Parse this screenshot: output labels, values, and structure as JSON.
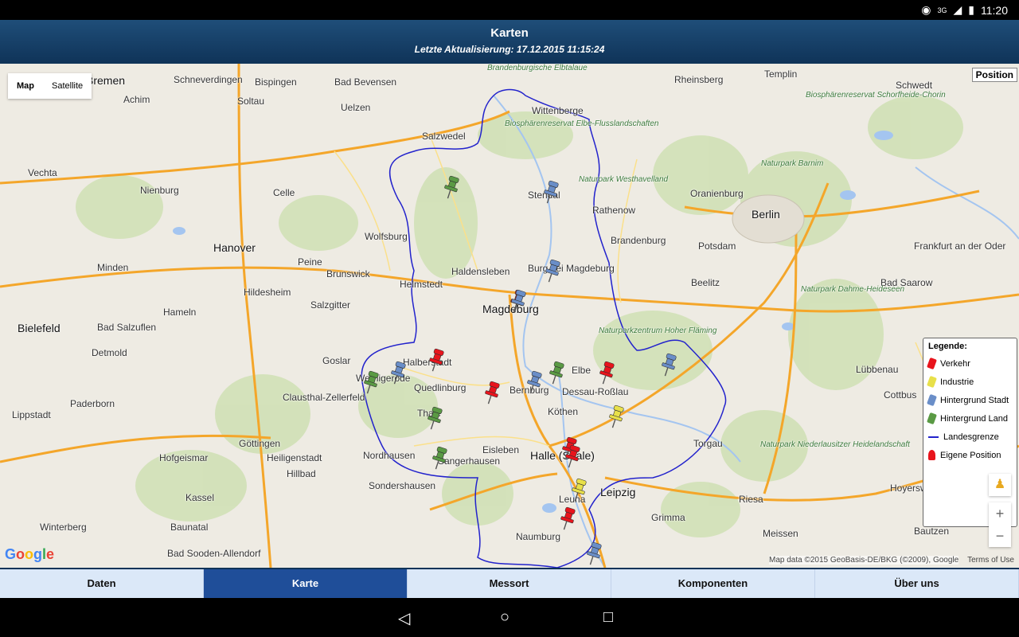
{
  "status": {
    "time": "11:20",
    "network": "3G"
  },
  "header": {
    "title": "Karten",
    "subtitle": "Letzte Aktualisierung: 17.12.2015 11:15:24"
  },
  "map": {
    "map_type_options": [
      "Map",
      "Satellite"
    ],
    "position_button": "Position",
    "places": [
      {
        "label": "Bremen",
        "big": true
      },
      {
        "label": "Schneverdingen"
      },
      {
        "label": "Bispingen"
      },
      {
        "label": "Bad Bevensen"
      },
      {
        "label": "Uelzen"
      },
      {
        "label": "Soltau"
      },
      {
        "label": "Achim"
      },
      {
        "label": "Vechta"
      },
      {
        "label": "Nienburg"
      },
      {
        "label": "Celle"
      },
      {
        "label": "Hanover",
        "big": true
      },
      {
        "label": "Wolfsburg"
      },
      {
        "label": "Peine"
      },
      {
        "label": "Brunswick"
      },
      {
        "label": "Minden"
      },
      {
        "label": "Hildesheim"
      },
      {
        "label": "Salzgitter"
      },
      {
        "label": "Hameln"
      },
      {
        "label": "Bielefeld",
        "big": true
      },
      {
        "label": "Bad Salzuflen"
      },
      {
        "label": "Detmold"
      },
      {
        "label": "Goslar"
      },
      {
        "label": "Paderborn"
      },
      {
        "label": "Clausthal-Zellerfeld"
      },
      {
        "label": "Lippstadt"
      },
      {
        "label": "Göttingen"
      },
      {
        "label": "Hofgeismar"
      },
      {
        "label": "Heiligenstadt"
      },
      {
        "label": "Kassel"
      },
      {
        "label": "Baunatal"
      },
      {
        "label": "Winterberg"
      },
      {
        "label": "Bad Sooden-Allendorf"
      },
      {
        "label": "Hillbad"
      },
      {
        "label": "Salzwedel"
      },
      {
        "label": "Wittenberge"
      },
      {
        "label": "Stendal"
      },
      {
        "label": "Haldensleben"
      },
      {
        "label": "Helmstedt"
      },
      {
        "label": "Burg bei Magdeburg"
      },
      {
        "label": "Magdeburg",
        "big": true
      },
      {
        "label": "Halberstadt"
      },
      {
        "label": "Wernigerode"
      },
      {
        "label": "Quedlinburg"
      },
      {
        "label": "Bernburg"
      },
      {
        "label": "Dessau-Roßlau"
      },
      {
        "label": "Köthen"
      },
      {
        "label": "Thale"
      },
      {
        "label": "Nordhausen"
      },
      {
        "label": "Sangerhausen"
      },
      {
        "label": "Eisleben"
      },
      {
        "label": "Halle (Saale)",
        "big": true
      },
      {
        "label": "Sondershausen"
      },
      {
        "label": "Leuna"
      },
      {
        "label": "Naumburg"
      },
      {
        "label": "Leipzig",
        "big": true
      },
      {
        "label": "Grimma"
      },
      {
        "label": "Riesa"
      },
      {
        "label": "Meissen"
      },
      {
        "label": "Torgau"
      },
      {
        "label": "Rheinsberg"
      },
      {
        "label": "Templin"
      },
      {
        "label": "Schwedt"
      },
      {
        "label": "Oranienburg"
      },
      {
        "label": "Rathenow"
      },
      {
        "label": "Berlin",
        "big": true
      },
      {
        "label": "Brandenburg"
      },
      {
        "label": "Potsdam"
      },
      {
        "label": "Frankfurt an der Oder"
      },
      {
        "label": "Beelitz"
      },
      {
        "label": "Bad Saarow"
      },
      {
        "label": "Lübbenau"
      },
      {
        "label": "Cottbus"
      },
      {
        "label": "Hoyerswerda"
      },
      {
        "label": "Bautzen"
      },
      {
        "label": "Elbe"
      },
      {
        "label": "Brandenburgische Elbtalaue",
        "green": true
      },
      {
        "label": "Biosphärenreservat Elbe-Flusslandschaften",
        "green": true
      },
      {
        "label": "Naturpark Westhavelland",
        "green": true
      },
      {
        "label": "Naturpark Barnim",
        "green": true
      },
      {
        "label": "Biosphärenreservat Schorfheide-Chorin",
        "green": true
      },
      {
        "label": "Naturpark Dahme-Heideseen",
        "green": true
      },
      {
        "label": "Naturparkzentrum Hoher Fläming",
        "green": true
      },
      {
        "label": "Naturpark Niederlausitzer Heidelandschaft",
        "green": true
      }
    ],
    "attribution": "Map data ©2015 GeoBasis-DE/BKG (©2009), Google",
    "terms": "Terms of Use",
    "google_logo": "Google"
  },
  "legend": {
    "title": "Legende:",
    "items": [
      {
        "label": "Verkehr",
        "color": "#e8141c"
      },
      {
        "label": "Industrie",
        "color": "#e8e04a"
      },
      {
        "label": "Hintergrund Stadt",
        "color": "#6a8ec8"
      },
      {
        "label": "Hintergrund Land",
        "color": "#5a9a44"
      },
      {
        "label": "Landesgrenze",
        "color": "#2222cc"
      },
      {
        "label": "Eigene Position",
        "color": "#e8141c"
      }
    ]
  },
  "tabs": [
    {
      "label": "Daten",
      "active": false
    },
    {
      "label": "Karte",
      "active": true
    },
    {
      "label": "Messort",
      "active": false
    },
    {
      "label": "Komponenten",
      "active": false
    },
    {
      "label": "Über uns",
      "active": false
    }
  ],
  "pins": [
    {
      "type": "Hintergrund Land",
      "color": "#5a9a44"
    },
    {
      "type": "Hintergrund Stadt",
      "color": "#6a8ec8"
    },
    {
      "type": "Hintergrund Stadt",
      "color": "#6a8ec8"
    },
    {
      "type": "Verkehr",
      "color": "#e8141c"
    },
    {
      "type": "Hintergrund Stadt",
      "color": "#6a8ec8"
    },
    {
      "type": "Hintergrund Land",
      "color": "#5a9a44"
    },
    {
      "type": "Hintergrund Stadt",
      "color": "#6a8ec8"
    },
    {
      "type": "Verkehr",
      "color": "#e8141c"
    },
    {
      "type": "Hintergrund Stadt",
      "color": "#6a8ec8"
    },
    {
      "type": "Hintergrund Land",
      "color": "#5a9a44"
    },
    {
      "type": "Verkehr",
      "color": "#e8141c"
    },
    {
      "type": "Verkehr",
      "color": "#e8141c"
    },
    {
      "type": "Hintergrund Stadt",
      "color": "#6a8ec8"
    },
    {
      "type": "Hintergrund Land",
      "color": "#5a9a44"
    },
    {
      "type": "Industrie",
      "color": "#e8e04a"
    },
    {
      "type": "Hintergrund Land",
      "color": "#5a9a44"
    },
    {
      "type": "Verkehr",
      "color": "#e8141c"
    },
    {
      "type": "Verkehr",
      "color": "#e8141c"
    },
    {
      "type": "Industrie",
      "color": "#e8e04a"
    },
    {
      "type": "Verkehr",
      "color": "#e8141c"
    },
    {
      "type": "Hintergrund Stadt",
      "color": "#6a8ec8"
    }
  ]
}
